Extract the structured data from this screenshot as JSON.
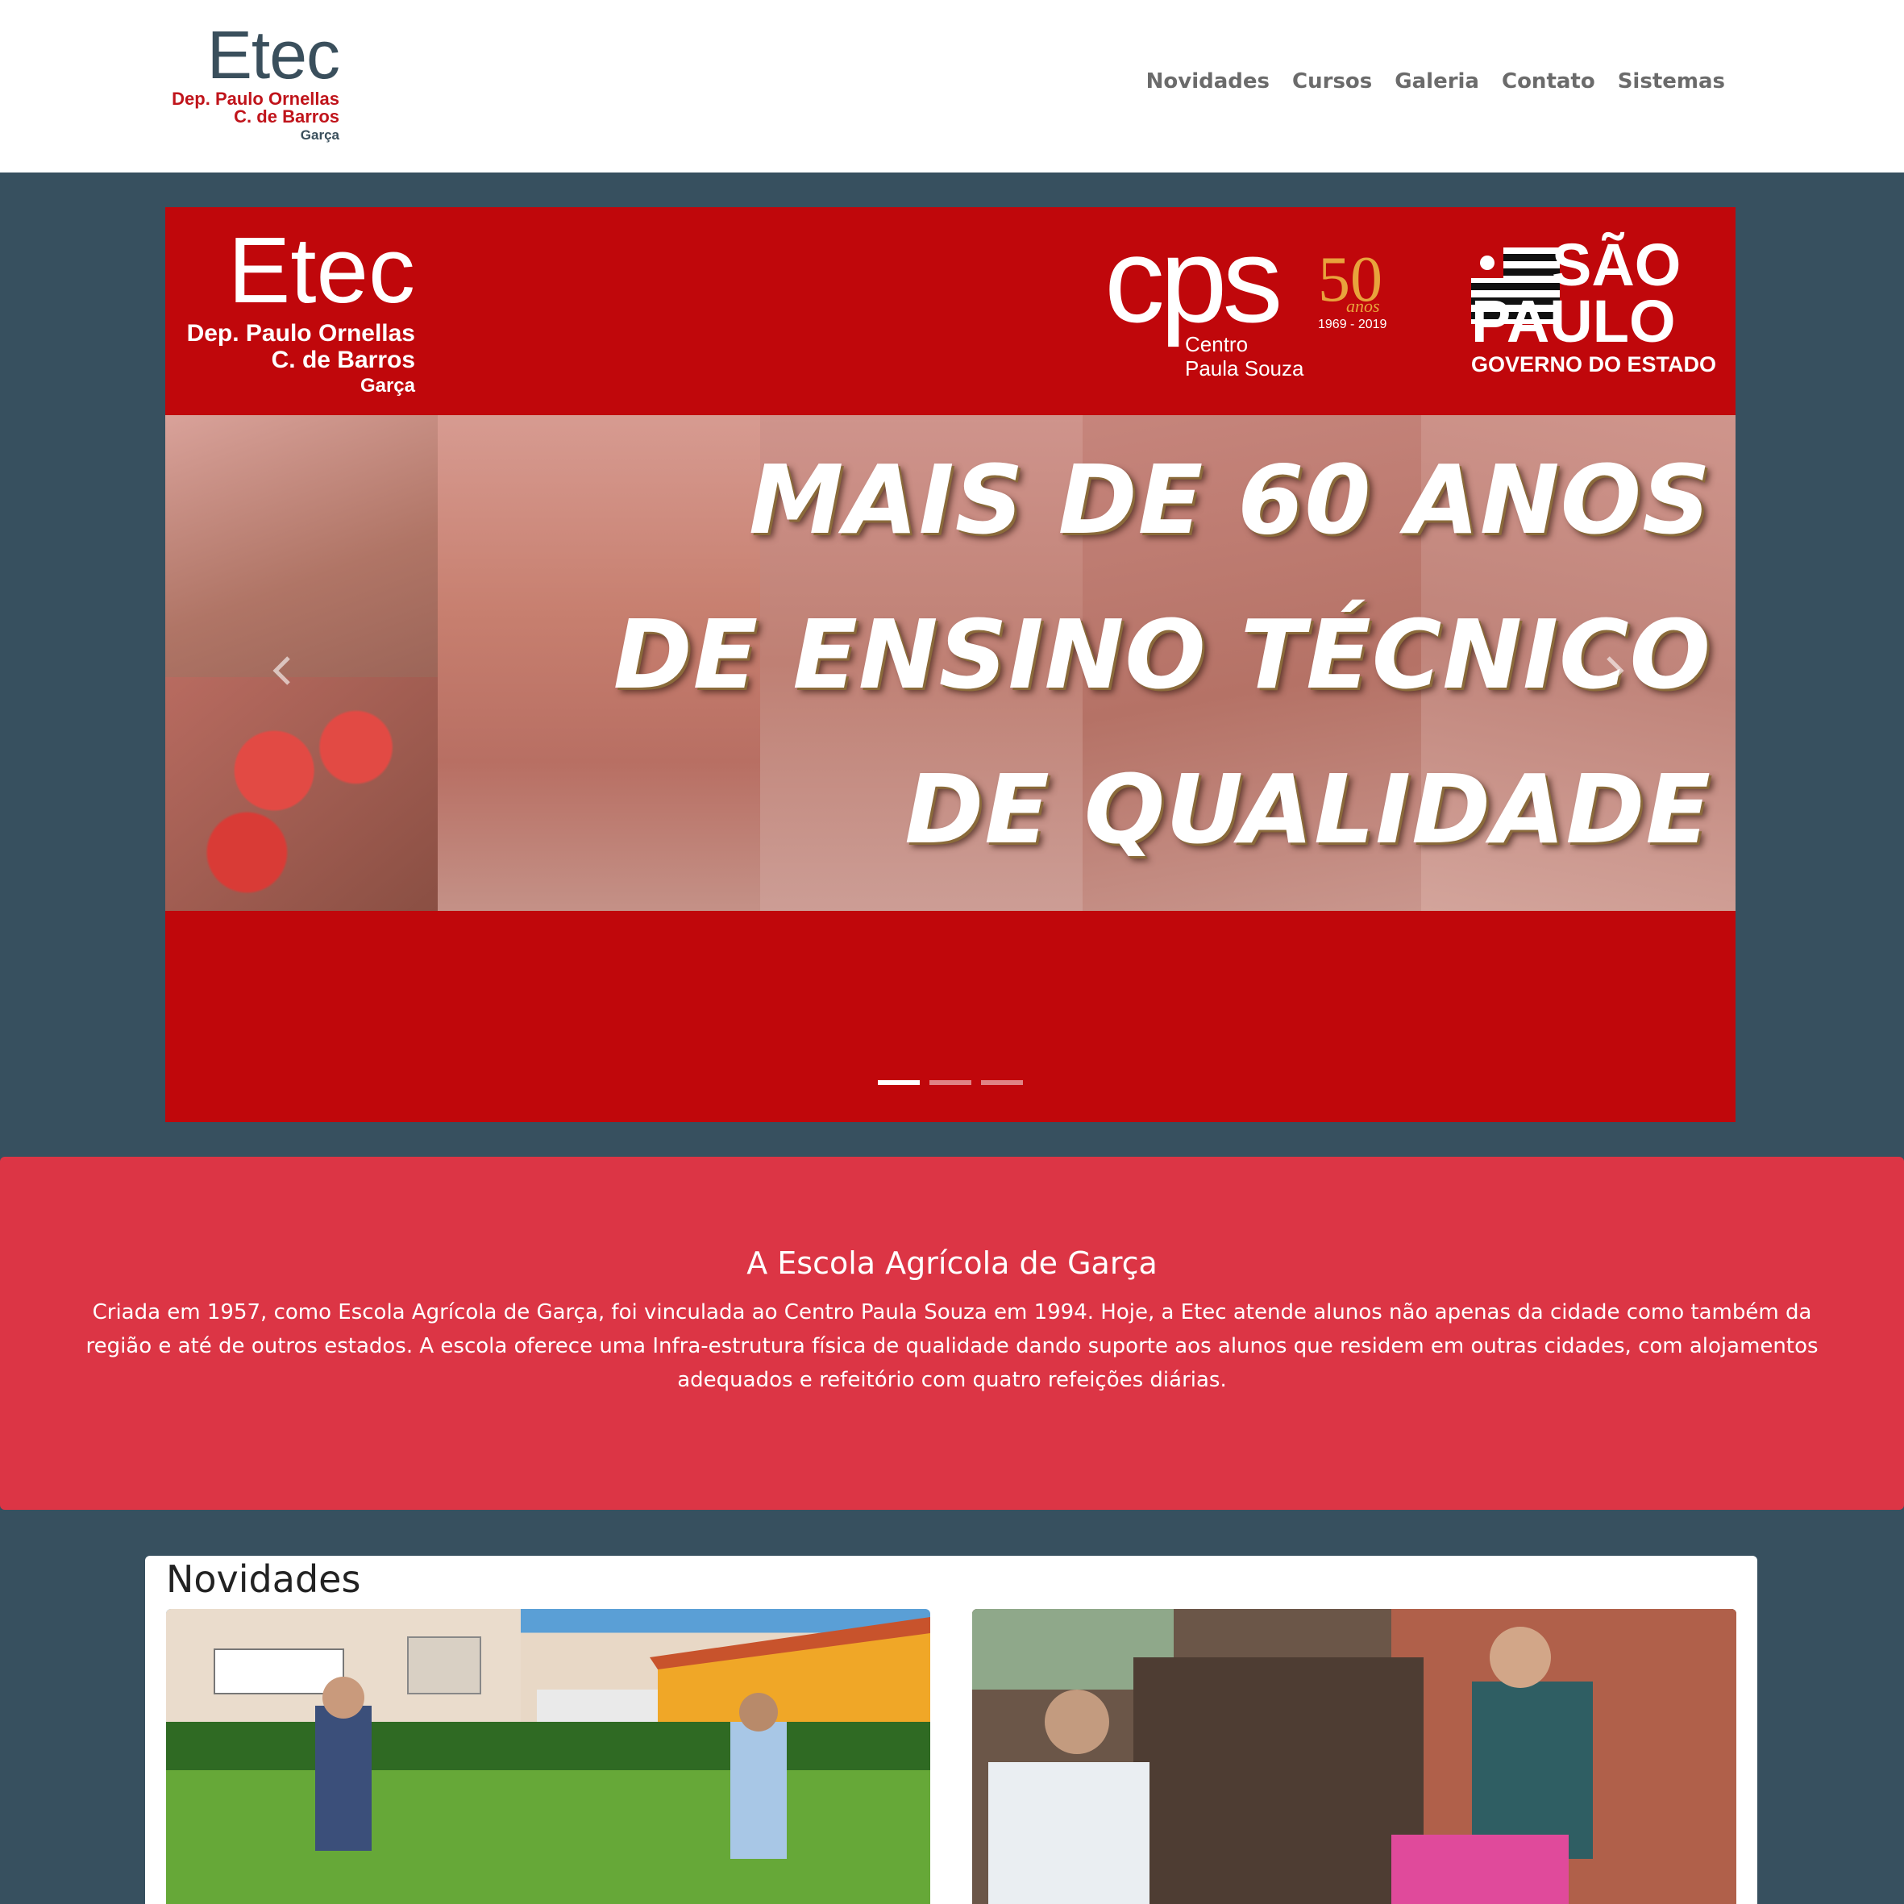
{
  "logo": {
    "name": "Etec",
    "line1": "Dep. Paulo Ornellas",
    "line2": "C. de Barros",
    "city": "Garça"
  },
  "nav": {
    "items": [
      "Novidades",
      "Cursos",
      "Galeria",
      "Contato",
      "Sistemas"
    ]
  },
  "carousel": {
    "slide": {
      "etec_name": "Etec",
      "etec_line1": "Dep. Paulo Ornellas",
      "etec_line2": "C. de Barros",
      "etec_city": "Garça",
      "cps_letters": "cps",
      "cps_name1": "Centro",
      "cps_name2": "Paula Souza",
      "cps_50": "50",
      "cps_anos": "anos",
      "cps_years": "1969 - 2019",
      "sp_line1": "SÃO",
      "sp_line2": "PAULO",
      "sp_line3": "GOVERNO DO ESTADO",
      "headline_1": "MAIS DE 60 ANOS",
      "headline_2": "DE ENSINO TÉCNICO",
      "headline_3": "DE QUALIDADE"
    },
    "slide_count": 3,
    "active_index": 0
  },
  "about": {
    "title": "A Escola Agrícola de Garça",
    "text": "Criada em 1957, como Escola Agrícola de Garça, foi vinculada ao Centro Paula Souza em 1994. Hoje, a Etec atende alunos não apenas da cidade como também da região e até de outros estados. A escola oferece uma Infra-estrutura física de qualidade dando suporte aos alunos que residem em outras cidades, com alojamentos adequados e refeitório com quatro refeições diárias."
  },
  "news": {
    "title": "Novidades"
  },
  "colors": {
    "page_bg": "#37505f",
    "banner_red": "#c0070b",
    "about_red": "#dc3545",
    "logo_red": "#c0141b",
    "logo_gray": "#3a4f5c"
  }
}
